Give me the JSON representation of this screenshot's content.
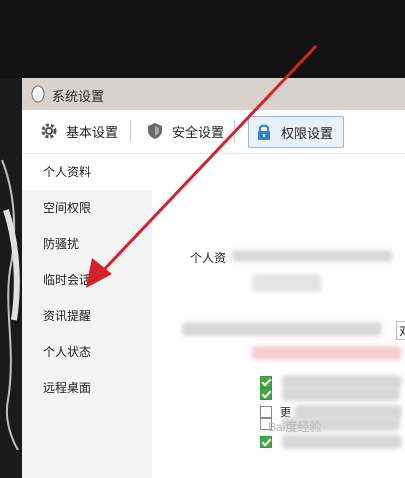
{
  "window": {
    "title": "系统设置"
  },
  "toolbar": {
    "basic_label": "基本设置",
    "security_label": "安全设置",
    "permission_label": "权限设置"
  },
  "sidebar": {
    "items": [
      {
        "label": "个人资料"
      },
      {
        "label": "空间权限"
      },
      {
        "label": "防骚扰"
      },
      {
        "label": "临时会话"
      },
      {
        "label": "资讯提醒"
      },
      {
        "label": "个人状态"
      },
      {
        "label": "远程桌面"
      }
    ]
  },
  "content": {
    "section_heading": "个人资",
    "field_value_fragment": "对",
    "link_fragment": "更",
    "checkbox_item_text": "更",
    "checkboxes": [
      true,
      false,
      true,
      true,
      false
    ]
  },
  "watermark": "Bai度经验",
  "colors": {
    "accent": "#d4222a",
    "check_green": "#45a845",
    "titlebar": "#d9d1cc",
    "sidebar_bg": "#f4f4f4"
  },
  "icons": {
    "title": "penguin-icon",
    "basic": "gear-icon",
    "security": "shield-icon",
    "permission": "lock-icon"
  }
}
